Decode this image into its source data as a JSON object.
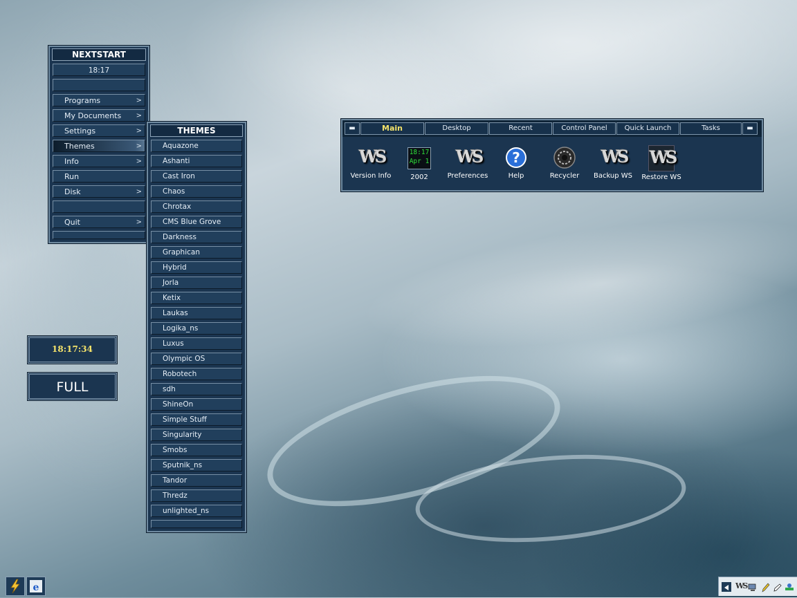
{
  "desktop": {
    "background": "silver-blue abstract"
  },
  "start_menu": {
    "title": "NEXTSTART",
    "time": "18:17",
    "items": [
      {
        "label": "Programs",
        "arrow": ">"
      },
      {
        "label": "My Documents",
        "arrow": ">"
      },
      {
        "label": "Settings",
        "arrow": ">"
      },
      {
        "label": "Themes",
        "arrow": ">"
      },
      {
        "label": "Info",
        "arrow": ">"
      },
      {
        "label": "Run",
        "arrow": ""
      },
      {
        "label": "Disk",
        "arrow": ">"
      },
      {
        "label": "Quit",
        "arrow": ">"
      }
    ]
  },
  "themes_menu": {
    "title": "THEMES",
    "items": [
      "Aquazone",
      "Ashanti",
      "Cast Iron",
      "Chaos",
      "Chrotax",
      "CMS Blue Grove",
      "Darkness",
      "Graphican",
      "Hybrid",
      "Jorla",
      "Ketix",
      "Laukas",
      "Logika_ns",
      "Luxus",
      "Olympic OS",
      "Robotech",
      "sdh",
      "ShineOn",
      "Simple Stuff",
      "Singularity",
      "Smobs",
      "Sputnik_ns",
      "Tandor",
      "Thredz",
      "unlighted_ns"
    ]
  },
  "clock_widget": {
    "time": "18:17:34"
  },
  "full_button": {
    "label": "FULL"
  },
  "launchbar": {
    "tabs": [
      "Main",
      "Desktop",
      "Recent",
      "Control Panel",
      "Quick Launch",
      "Tasks"
    ],
    "active_tab": "Main",
    "calendar_icon": {
      "time": "18:17",
      "date": "Apr 1"
    },
    "items": [
      {
        "label": "Version Info",
        "icon": "ws-logo-icon"
      },
      {
        "label": "2002",
        "icon": "calendar-icon"
      },
      {
        "label": "Preferences",
        "icon": "ws-logo-icon"
      },
      {
        "label": "Help",
        "icon": "help-icon"
      },
      {
        "label": "Recycler",
        "icon": "recycler-icon"
      },
      {
        "label": "Backup WS",
        "icon": "ws-logo-icon"
      },
      {
        "label": "Restore WS",
        "icon": "ws-logo-icon"
      }
    ],
    "colors": {
      "active_tab_text": "#f5e36a",
      "panel": "#1b3550",
      "calendar_text": "#2fe03a"
    }
  },
  "taskbar": {
    "left_icons": [
      "lightning-icon",
      "web-browser-icon"
    ],
    "tray_icons": [
      "arrow-left-icon",
      "ws-logo-icon",
      "monitor-icon",
      "pencil-icon",
      "pen-icon",
      "network-icon"
    ]
  }
}
